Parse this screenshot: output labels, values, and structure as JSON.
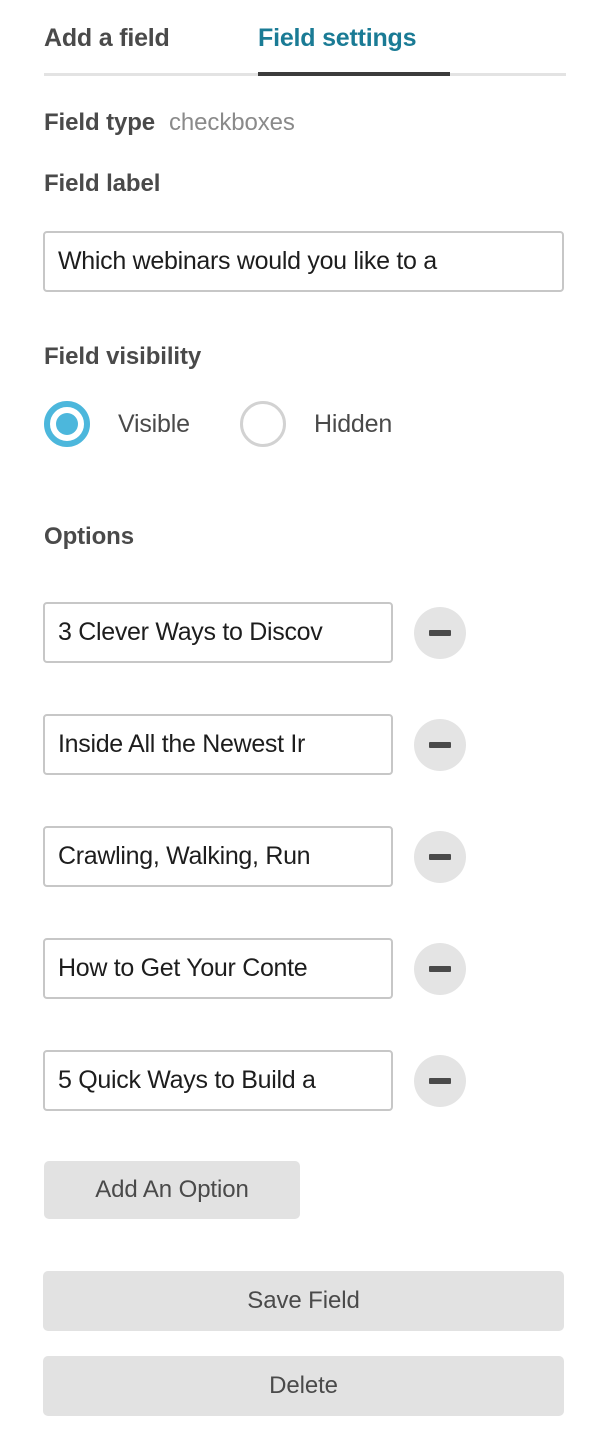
{
  "tabs": [
    {
      "label": "Add a field",
      "active": false
    },
    {
      "label": "Field settings",
      "active": true
    }
  ],
  "field_type": {
    "label": "Field type",
    "value": "checkboxes"
  },
  "field_label": {
    "heading": "Field label",
    "value": "Which webinars would you like to a"
  },
  "field_visibility": {
    "heading": "Field visibility",
    "selected": "Visible",
    "options": [
      {
        "label": "Visible",
        "checked": true
      },
      {
        "label": "Hidden",
        "checked": false
      }
    ]
  },
  "options_section": {
    "heading": "Options",
    "remove_icon": "minus-icon",
    "items": [
      {
        "value": "3 Clever Ways to Discov"
      },
      {
        "value": "Inside All the Newest Ir"
      },
      {
        "value": "Crawling, Walking, Run"
      },
      {
        "value": "How to Get Your Conte"
      },
      {
        "value": "5 Quick Ways to Build a"
      }
    ],
    "add_option_label": "Add An Option"
  },
  "actions": {
    "save_label": "Save Field",
    "delete_label": "Delete"
  },
  "colors": {
    "accent_teal": "#1a7b95",
    "accent_cyan": "#4cb7dc",
    "text_dark": "#4a4a4a",
    "text_muted": "#8a8a8a",
    "input_border": "#c7c7c7",
    "button_bg": "#e2e2e2",
    "rule": "#e3e3e3",
    "rule_active": "#3c3c3c"
  }
}
